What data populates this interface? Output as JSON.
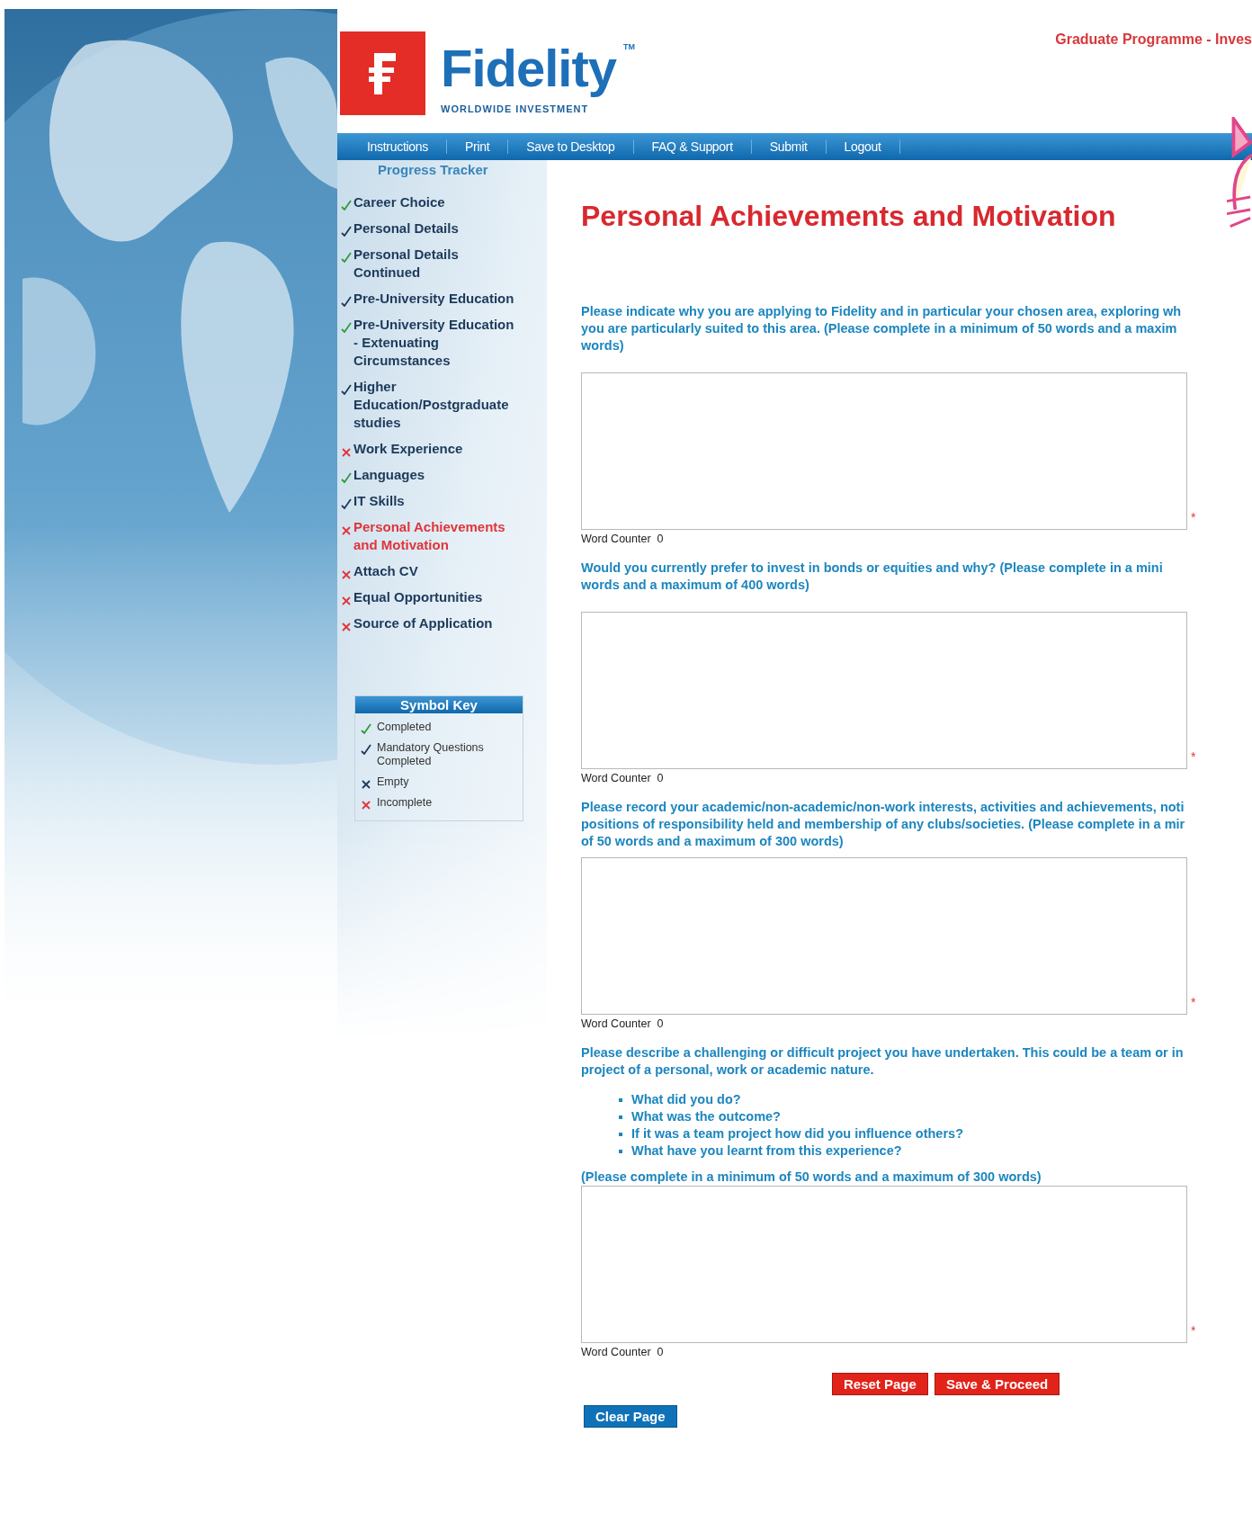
{
  "header": {
    "brand": "Fidelity",
    "trademark": "TM",
    "tagline": "WORLDWIDE INVESTMENT",
    "programme": "Graduate Programme - Inves"
  },
  "nav": [
    "Instructions",
    "Print",
    "Save to Desktop",
    "FAQ & Support",
    "Submit",
    "Logout"
  ],
  "sidebar": {
    "title": "Progress Tracker",
    "items": [
      {
        "label": "Career Choice",
        "kind": "completed",
        "selected": false
      },
      {
        "label": "Personal Details",
        "kind": "mandatory",
        "selected": false
      },
      {
        "label": "Personal Details\nContinued",
        "kind": "completed",
        "selected": false
      },
      {
        "label": "Pre-University Education",
        "kind": "mandatory",
        "selected": false
      },
      {
        "label": "Pre-University Education\n- Extenuating\nCircumstances",
        "kind": "completed",
        "selected": false
      },
      {
        "label": "Higher\nEducation/Postgraduate\nstudies",
        "kind": "mandatory",
        "selected": false
      },
      {
        "label": "Work Experience",
        "kind": "incomplete",
        "selected": false
      },
      {
        "label": "Languages",
        "kind": "completed",
        "selected": false
      },
      {
        "label": "IT Skills",
        "kind": "mandatory",
        "selected": false
      },
      {
        "label": "Personal Achievements\nand Motivation",
        "kind": "incomplete",
        "selected": true
      },
      {
        "label": "Attach CV",
        "kind": "incomplete",
        "selected": false
      },
      {
        "label": "Equal Opportunities",
        "kind": "incomplete",
        "selected": false
      },
      {
        "label": "Source of Application",
        "kind": "incomplete",
        "selected": false
      }
    ],
    "key": {
      "title": "Symbol Key",
      "items": [
        {
          "label": "Completed",
          "kind": "completed"
        },
        {
          "label": "Mandatory Questions\nCompleted",
          "kind": "mandatory"
        },
        {
          "label": "Empty",
          "kind": "empty"
        },
        {
          "label": "Incomplete",
          "kind": "incomplete"
        }
      ]
    }
  },
  "page_title": "Personal Achievements and Motivation",
  "questions": [
    {
      "text": "Please indicate why you are applying to Fidelity and in particular your chosen area, exploring wh\nyou are particularly suited to this area. (Please complete in a minimum of 50 words and a maxim\nwords)",
      "word_counter": "Word Counter  0",
      "required_mark": "*"
    },
    {
      "text": "Would you currently prefer to invest in bonds or equities and why? (Please complete in a mini\nwords and a maximum of 400 words)",
      "word_counter": "Word Counter  0",
      "required_mark": "*"
    },
    {
      "text": "Please record your academic/non-academic/non-work interests, activities and achievements, noti\npositions of responsibility held and membership of any clubs/societies. (Please complete in a mir\nof 50 words and a maximum of 300 words)",
      "word_counter": "Word Counter  0",
      "required_mark": "*"
    },
    {
      "text": "Please describe a challenging or difficult project you have undertaken. This could be a team or in\nproject of a personal, work or academic nature.",
      "bullets": [
        "What did you do?",
        "What was the outcome?",
        "If it was a team project how did you influence others?",
        "What have you learnt from this experience?"
      ],
      "note": "(Please complete in a minimum of 50 words and a maximum of 300 words)",
      "word_counter": "Word Counter  0",
      "required_mark": "*"
    }
  ],
  "buttons": {
    "reset": "Reset Page",
    "save": "Save & Proceed",
    "clear": "Clear Page"
  }
}
